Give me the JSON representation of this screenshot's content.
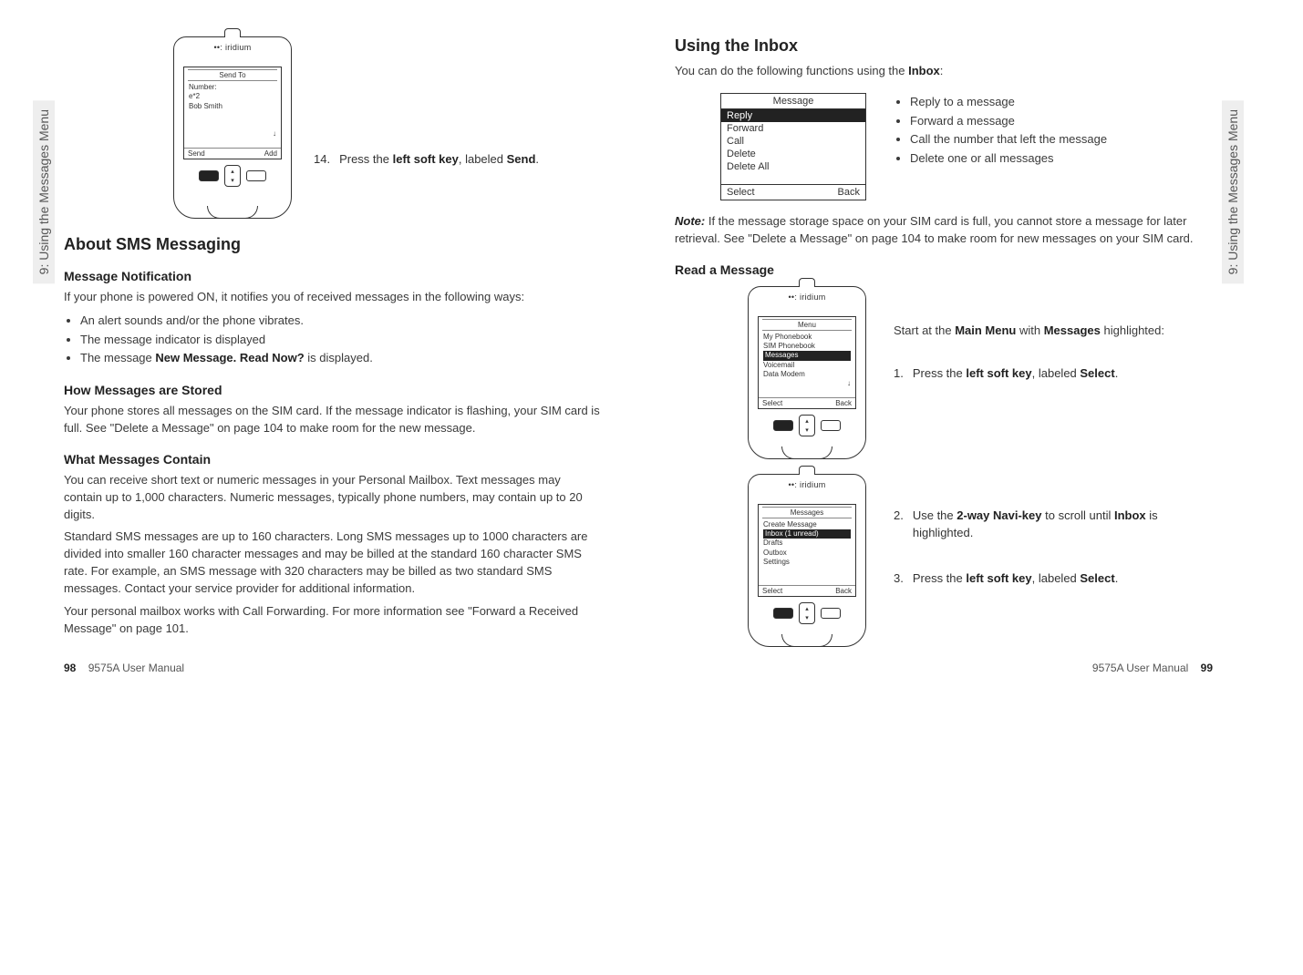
{
  "common": {
    "side_tab": "9: Using the Messages Menu",
    "manual_name": "9575A User Manual"
  },
  "left_page": {
    "page_num": "98",
    "phone1": {
      "brand": "iridium",
      "title": "Send To",
      "line1": "Number:",
      "line2": "e*2",
      "line3": "Bob Smith",
      "soft_left": "Send",
      "soft_right": "Add"
    },
    "step14_num": "14.",
    "step14_a": "Press the ",
    "step14_b": "left soft key",
    "step14_c": ", labeled ",
    "step14_d": "Send",
    "step14_e": ".",
    "h_about": "About SMS Messaging",
    "h_notif": "Message Notification",
    "p_notif": "If your phone is powered ON, it notifies you of received messages in the following ways:",
    "notif_items": [
      "An alert sounds and/or the phone vibrates.",
      "The message indicator is displayed"
    ],
    "notif_item3_a": "The message ",
    "notif_item3_b": "New Message. Read Now?",
    "notif_item3_c": " is displayed.",
    "h_stored": "How Messages are Stored",
    "p_stored": "Your phone stores all messages on the SIM card. If the message indicator is flashing, your SIM card is full. See \"Delete a Message\" on page 104 to make room for the new message.",
    "h_contain": "What Messages Contain",
    "p_contain1": "You can receive short text or numeric messages in your Personal Mailbox. Text messages may contain up to 1,000 characters. Numeric messages, typically phone numbers, may contain up to 20 digits.",
    "p_contain2": "Standard SMS messages are up to 160 characters. Long SMS messages up to 1000 characters are divided into smaller 160 character messages and may be billed at the standard 160 character SMS rate. For example, an SMS message with 320 characters may be billed as two standard SMS messages. Contact your service provider for additional information.",
    "p_contain3": "Your personal mailbox works with Call Forwarding. For more information see \"Forward a Received Message\" on page 101."
  },
  "right_page": {
    "page_num": "99",
    "h_inbox": "Using the Inbox",
    "p_inbox_a": "You can do the following functions using the ",
    "p_inbox_b": "Inbox",
    "p_inbox_c": ":",
    "msgbox": {
      "title": "Message",
      "items": [
        "Reply",
        "Forward",
        "Call",
        "Delete",
        "Delete All"
      ],
      "soft_left": "Select",
      "soft_right": "Back"
    },
    "inbox_points": [
      "Reply to a message",
      "Forward a message",
      "Call the number that left the message",
      "Delete one or all messages"
    ],
    "note_label": "Note:",
    "note_body": " If the message storage space on your SIM card is full, you cannot store a message for later retrieval. See \"Delete a Message\" on page 104 to make room for new messages on your SIM card.",
    "h_read": "Read a Message",
    "phone_menu": {
      "brand": "iridium",
      "title": "Menu",
      "items": [
        "My Phonebook",
        "SIM Phonebook",
        "Messages",
        "Voicemail",
        "Data Modem"
      ],
      "hl_index": 2,
      "soft_left": "Select",
      "soft_right": "Back"
    },
    "menu_intro_a": "Start at the ",
    "menu_intro_b": "Main Menu",
    "menu_intro_c": " with ",
    "menu_intro_d": "Messages",
    "menu_intro_e": " highlighted:",
    "step1_num": "1.",
    "step1_a": "Press the ",
    "step1_b": "left soft key",
    "step1_c": ", labeled ",
    "step1_d": "Select",
    "step1_e": ".",
    "phone_msgs": {
      "brand": "iridium",
      "title": "Messages",
      "items": [
        "Create Message",
        "Inbox (1 unread)",
        "Drafts",
        "Outbox",
        "Settings"
      ],
      "hl_index": 1,
      "soft_left": "Select",
      "soft_right": "Back"
    },
    "step2_num": "2.",
    "step2_a": "Use the ",
    "step2_b": "2-way Navi-key",
    "step2_c": " to scroll until ",
    "step2_d": "Inbox",
    "step2_e": " is highlighted.",
    "step3_num": "3.",
    "step3_a": "Press the ",
    "step3_b": "left soft key",
    "step3_c": ", labeled ",
    "step3_d": "Select",
    "step3_e": "."
  }
}
